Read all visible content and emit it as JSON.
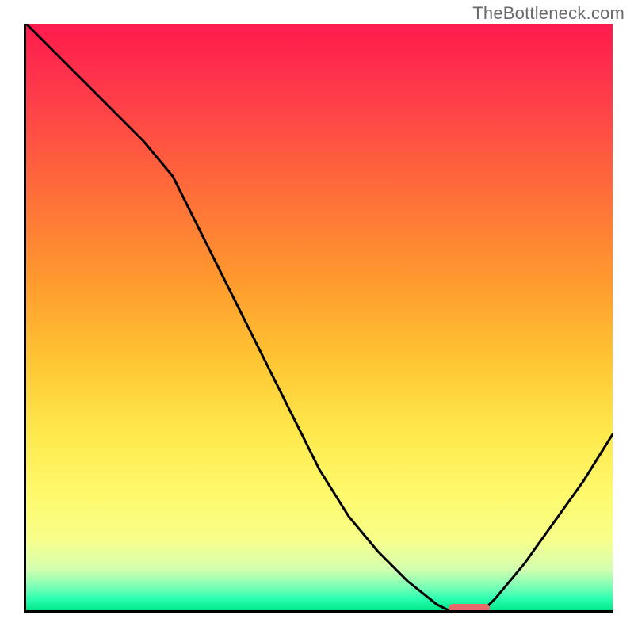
{
  "watermark": "TheBottleneck.com",
  "chart_data": {
    "type": "line",
    "x": [
      0,
      5,
      10,
      15,
      20,
      25,
      30,
      35,
      40,
      45,
      50,
      55,
      60,
      65,
      70,
      72,
      74,
      78,
      80,
      85,
      90,
      95,
      100
    ],
    "y": [
      100,
      95,
      90,
      85,
      80,
      74,
      64,
      54,
      44,
      34,
      24,
      16,
      10,
      5,
      1,
      0,
      0,
      0,
      2,
      8,
      15,
      22,
      30
    ],
    "title": "",
    "xlabel": "",
    "ylabel": "",
    "xlim": [
      0,
      100
    ],
    "ylim": [
      0,
      100
    ],
    "marker": {
      "x_start": 72,
      "x_end": 79,
      "y": 0
    },
    "background_gradient": {
      "top": "#ff1a4d",
      "mid": "#ffc733",
      "bottom": "#00e88a"
    }
  }
}
